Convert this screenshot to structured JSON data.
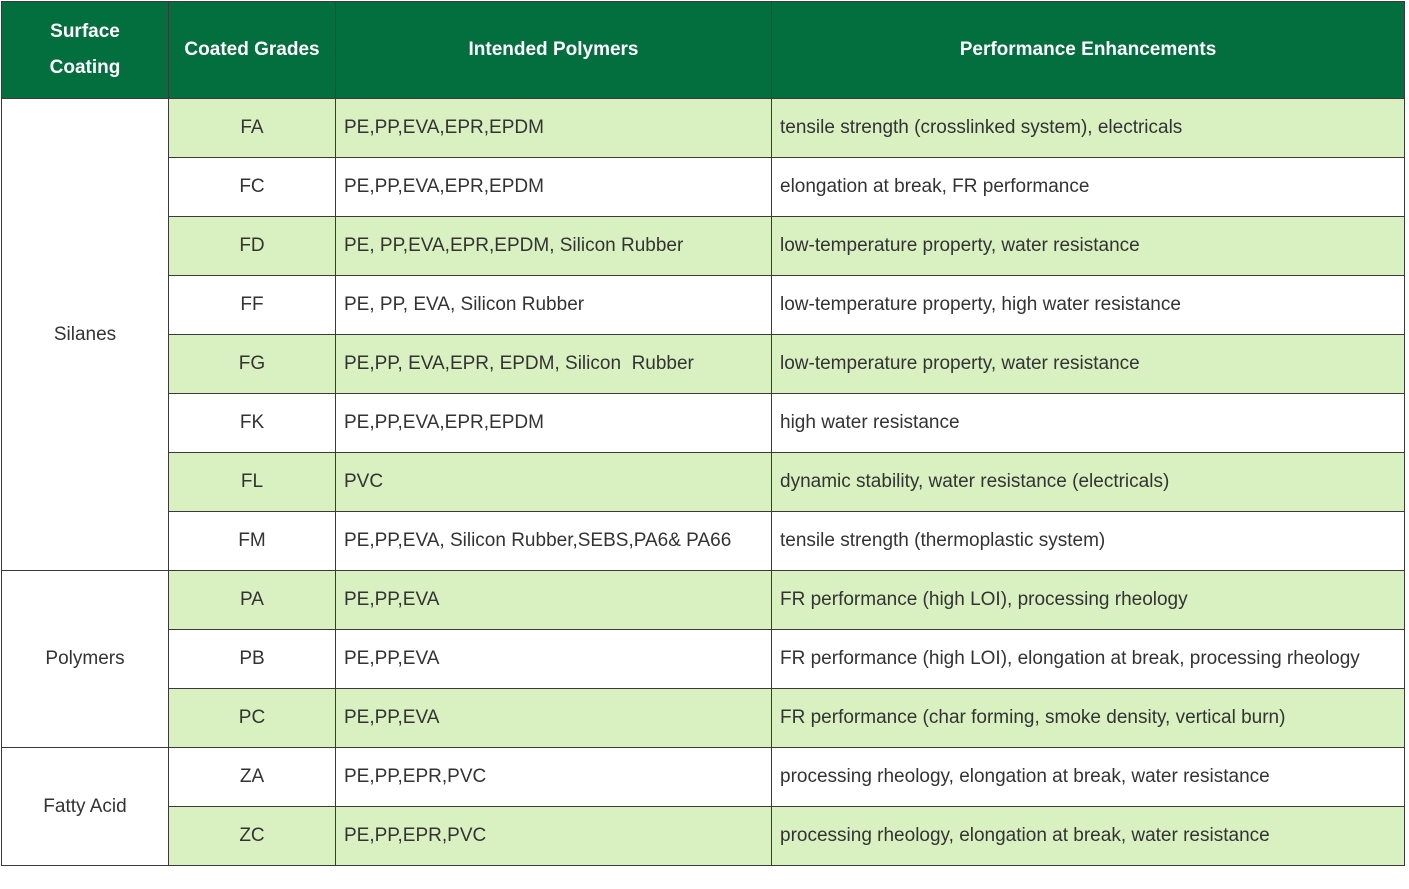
{
  "colors": {
    "header_bg": "#036f3e",
    "alt_row_bg": "#d9f1c1",
    "border": "#3a3a3a"
  },
  "header": {
    "surface_coating_line1": "Surface",
    "surface_coating_line2": "Coating",
    "coated_grades": "Coated Grades",
    "intended_polymers": "Intended Polymers",
    "performance_enhancements": "Performance Enhancements"
  },
  "groups": [
    {
      "name": "Silanes",
      "rows": [
        {
          "grade": "FA",
          "polymers": "PE,PP,EVA,EPR,EPDM",
          "enhancements": "tensile strength (crosslinked system), electricals"
        },
        {
          "grade": "FC",
          "polymers": "PE,PP,EVA,EPR,EPDM",
          "enhancements": "elongation at break, FR performance"
        },
        {
          "grade": "FD",
          "polymers": "PE, PP,EVA,EPR,EPDM, Silicon Rubber",
          "enhancements": "low-temperature property, water resistance"
        },
        {
          "grade": "FF",
          "polymers": "PE, PP, EVA, Silicon Rubber",
          "enhancements": "low-temperature property, high water resistance"
        },
        {
          "grade": "FG",
          "polymers": "PE,PP, EVA,EPR, EPDM, Silicon  Rubber",
          "enhancements": "low-temperature property, water resistance"
        },
        {
          "grade": "FK",
          "polymers": "PE,PP,EVA,EPR,EPDM",
          "enhancements": "high water resistance"
        },
        {
          "grade": "FL",
          "polymers": "PVC",
          "enhancements": "dynamic stability, water resistance (electricals)"
        },
        {
          "grade": "FM",
          "polymers": "PE,PP,EVA, Silicon Rubber,SEBS,PA6& PA66",
          "enhancements": "tensile strength (thermoplastic system)"
        }
      ]
    },
    {
      "name": "Polymers",
      "rows": [
        {
          "grade": "PA",
          "polymers": "PE,PP,EVA",
          "enhancements": "FR performance (high LOI), processing rheology"
        },
        {
          "grade": "PB",
          "polymers": "PE,PP,EVA",
          "enhancements": "FR performance (high LOI), elongation at break, processing rheology"
        },
        {
          "grade": "PC",
          "polymers": "PE,PP,EVA",
          "enhancements": "FR performance (char forming, smoke density, vertical burn)"
        }
      ]
    },
    {
      "name": "Fatty Acid",
      "rows": [
        {
          "grade": "ZA",
          "polymers": "PE,PP,EPR,PVC",
          "enhancements": "processing rheology, elongation at break, water resistance"
        },
        {
          "grade": "ZC",
          "polymers": "PE,PP,EPR,PVC",
          "enhancements": "processing rheology, elongation at break, water resistance"
        }
      ]
    }
  ]
}
